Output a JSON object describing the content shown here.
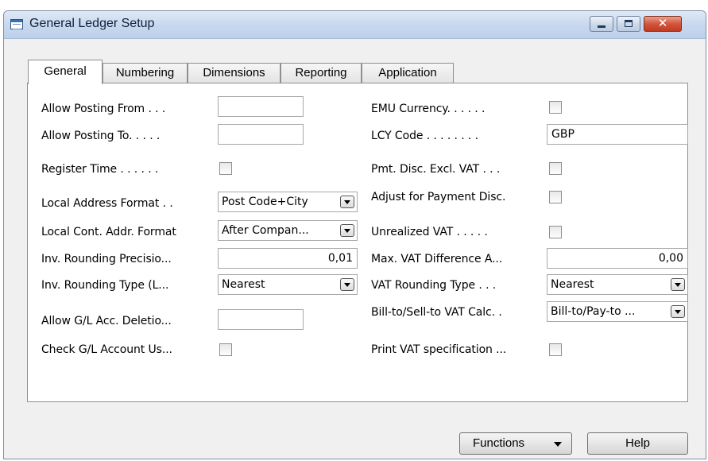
{
  "window": {
    "title": "General Ledger Setup"
  },
  "tabs": [
    {
      "label": "General",
      "active": true
    },
    {
      "label": "Numbering",
      "active": false
    },
    {
      "label": "Dimensions",
      "active": false
    },
    {
      "label": "Reporting",
      "active": false
    },
    {
      "label": "Application",
      "active": false
    }
  ],
  "left": {
    "allow_posting_from": {
      "label": "Allow Posting From  . . .",
      "value": ""
    },
    "allow_posting_to": {
      "label": "Allow Posting To. . . . .",
      "value": ""
    },
    "register_time": {
      "label": "Register Time . . . . . .",
      "checked": false
    },
    "local_address_format": {
      "label": "Local Address Format . .",
      "value": "Post Code+City"
    },
    "local_cont_addr_format": {
      "label": "Local Cont. Addr. Format",
      "value": "After Compan..."
    },
    "inv_rounding_precision": {
      "label": "Inv. Rounding Precisio...",
      "value": "0,01"
    },
    "inv_rounding_type": {
      "label": "Inv. Rounding Type (L...",
      "value": "Nearest"
    },
    "allow_gl_acc_deletion": {
      "label": "Allow G/L Acc. Deletio...",
      "value": ""
    },
    "check_gl_account_usage": {
      "label": "Check G/L Account Us...",
      "checked": false
    }
  },
  "right": {
    "emu_currency": {
      "label": "EMU Currency. . . . . .",
      "checked": false
    },
    "lcy_code": {
      "label": "LCY Code . . . . . . . .",
      "value": "GBP"
    },
    "pmt_disc_excl_vat": {
      "label": "Pmt. Disc. Excl. VAT . . .",
      "checked": false
    },
    "adjust_payment_disc": {
      "label": "Adjust for Payment Disc.",
      "checked": false
    },
    "unrealized_vat": {
      "label": "Unrealized VAT . . . . .",
      "checked": false
    },
    "max_vat_difference": {
      "label": "Max. VAT Difference A...",
      "value": "0,00"
    },
    "vat_rounding_type": {
      "label": "VAT Rounding Type . . .",
      "value": "Nearest"
    },
    "bill_sell_vat_calc": {
      "label": "Bill-to/Sell-to VAT Calc.  .",
      "value": "Bill-to/Pay-to ..."
    },
    "print_vat_spec": {
      "label": "Print VAT specification ...",
      "checked": false
    }
  },
  "buttons": {
    "functions": "Functions",
    "help": "Help"
  },
  "icons": {
    "app": "table-window-icon",
    "minimize": "minimize-icon",
    "maximize": "maximize-icon",
    "close": "close-icon",
    "dropdown": "chevron-down-icon"
  },
  "colors": {
    "titlebar": "#c7d7ee",
    "close_button": "#c23a22"
  }
}
